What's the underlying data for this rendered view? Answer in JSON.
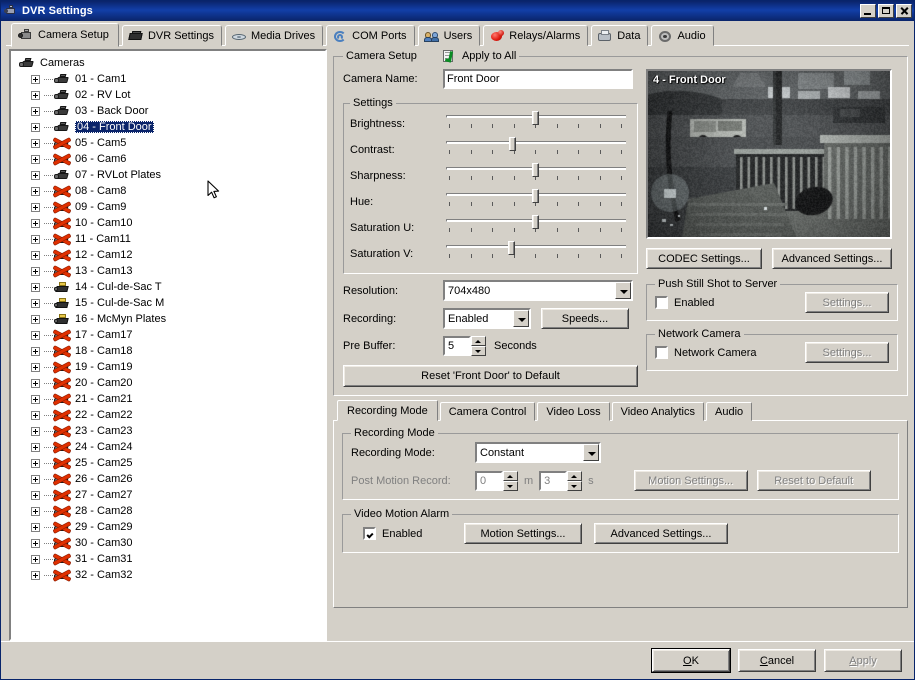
{
  "window": {
    "title": "DVR Settings",
    "icon": "camera-icon",
    "controls": {
      "minimize": "minimize-icon",
      "maximize": "maximize-icon",
      "close": "close-icon"
    }
  },
  "main_tabs": [
    {
      "label": "Camera Setup",
      "icon": "camera-icon",
      "active": true
    },
    {
      "label": "DVR Settings",
      "icon": "dvr-icon",
      "active": false
    },
    {
      "label": "Media Drives",
      "icon": "disc-icon",
      "active": false
    },
    {
      "label": "COM Ports",
      "icon": "com-port-icon",
      "active": false
    },
    {
      "label": "Users",
      "icon": "users-icon",
      "active": false
    },
    {
      "label": "Relays/Alarms",
      "icon": "relay-icon",
      "active": false
    },
    {
      "label": "Data",
      "icon": "data-icon",
      "active": false
    },
    {
      "label": "Audio",
      "icon": "audio-icon",
      "active": false
    }
  ],
  "tree": {
    "root_label": "Cameras",
    "root_icon": "camera-icon",
    "nodes": [
      {
        "label": "01 - Cam1",
        "icon": "camera-icon",
        "selected": false
      },
      {
        "label": "02 - RV Lot",
        "icon": "camera-icon",
        "selected": false
      },
      {
        "label": "03 - Back Door",
        "icon": "camera-icon",
        "selected": false
      },
      {
        "label": "04 - Front Door",
        "icon": "camera-icon",
        "selected": true
      },
      {
        "label": "05 - Cam5",
        "icon": "camera-disabled-icon",
        "selected": false
      },
      {
        "label": "06 - Cam6",
        "icon": "camera-disabled-icon",
        "selected": false
      },
      {
        "label": "07 - RVLot Plates",
        "icon": "camera-icon",
        "selected": false
      },
      {
        "label": "08 - Cam8",
        "icon": "camera-disabled-icon",
        "selected": false
      },
      {
        "label": "09 - Cam9",
        "icon": "camera-disabled-icon",
        "selected": false
      },
      {
        "label": "10 - Cam10",
        "icon": "camera-disabled-icon",
        "selected": false
      },
      {
        "label": "11 - Cam11",
        "icon": "camera-disabled-icon",
        "selected": false
      },
      {
        "label": "12 - Cam12",
        "icon": "camera-disabled-icon",
        "selected": false
      },
      {
        "label": "13 - Cam13",
        "icon": "camera-disabled-icon",
        "selected": false
      },
      {
        "label": "14 - Cul-de-Sac T",
        "icon": "camera-ptz-icon",
        "selected": false
      },
      {
        "label": "15 - Cul-de-Sac M",
        "icon": "camera-ptz-icon",
        "selected": false
      },
      {
        "label": "16 - McMyn Plates",
        "icon": "camera-ptz-icon",
        "selected": false
      },
      {
        "label": "17 - Cam17",
        "icon": "camera-disabled-icon",
        "selected": false
      },
      {
        "label": "18 - Cam18",
        "icon": "camera-disabled-icon",
        "selected": false
      },
      {
        "label": "19 - Cam19",
        "icon": "camera-disabled-icon",
        "selected": false
      },
      {
        "label": "20 - Cam20",
        "icon": "camera-disabled-icon",
        "selected": false
      },
      {
        "label": "21 - Cam21",
        "icon": "camera-disabled-icon",
        "selected": false
      },
      {
        "label": "22 - Cam22",
        "icon": "camera-disabled-icon",
        "selected": false
      },
      {
        "label": "23 - Cam23",
        "icon": "camera-disabled-icon",
        "selected": false
      },
      {
        "label": "24 - Cam24",
        "icon": "camera-disabled-icon",
        "selected": false
      },
      {
        "label": "25 - Cam25",
        "icon": "camera-disabled-icon",
        "selected": false
      },
      {
        "label": "26 - Cam26",
        "icon": "camera-disabled-icon",
        "selected": false
      },
      {
        "label": "27 - Cam27",
        "icon": "camera-disabled-icon",
        "selected": false
      },
      {
        "label": "28 - Cam28",
        "icon": "camera-disabled-icon",
        "selected": false
      },
      {
        "label": "29 - Cam29",
        "icon": "camera-disabled-icon",
        "selected": false
      },
      {
        "label": "30 - Cam30",
        "icon": "camera-disabled-icon",
        "selected": false
      },
      {
        "label": "31 - Cam31",
        "icon": "camera-disabled-icon",
        "selected": false
      },
      {
        "label": "32 - Cam32",
        "icon": "camera-disabled-icon",
        "selected": false
      }
    ]
  },
  "camera_setup": {
    "group_title": "Camera Setup",
    "apply_to_all_label": "Apply to All",
    "camera_name_label": "Camera Name:",
    "camera_name_value": "Front Door",
    "settings_group_title": "Settings",
    "sliders": [
      {
        "label": "Brightness:",
        "value": 50
      },
      {
        "label": "Contrast:",
        "value": 37
      },
      {
        "label": "Sharpness:",
        "value": 50
      },
      {
        "label": "Hue:",
        "value": 50
      },
      {
        "label": "Saturation U:",
        "value": 50
      },
      {
        "label": "Saturation V:",
        "value": 36
      }
    ],
    "slider_tick_count": 9,
    "resolution_label": "Resolution:",
    "resolution_value": "704x480",
    "recording_label": "Recording:",
    "recording_value": "Enabled",
    "speeds_button": "Speeds...",
    "pre_buffer_label": "Pre Buffer:",
    "pre_buffer_value": "5",
    "pre_buffer_units": "Seconds",
    "reset_button": "Reset 'Front Door' to Default"
  },
  "preview": {
    "overlay_label": "4 - Front Door"
  },
  "right_column": {
    "codec_button": "CODEC Settings...",
    "advanced_button": "Advanced Settings...",
    "push_still": {
      "group_title": "Push Still Shot to Server",
      "enabled_label": "Enabled",
      "enabled_checked": false,
      "settings_button": "Settings...",
      "settings_disabled": true
    },
    "network_camera": {
      "group_title": "Network Camera",
      "enabled_label": "Network Camera",
      "enabled_checked": false,
      "settings_button": "Settings...",
      "settings_disabled": true
    }
  },
  "bottom_tabs": [
    {
      "label": "Recording Mode",
      "active": true
    },
    {
      "label": "Camera Control",
      "active": false
    },
    {
      "label": "Video Loss",
      "active": false
    },
    {
      "label": "Video Analytics",
      "active": false
    },
    {
      "label": "Audio",
      "active": false
    }
  ],
  "recording_mode_panel": {
    "group_title": "Recording Mode",
    "mode_label": "Recording Mode:",
    "mode_value": "Constant",
    "post_motion_label": "Post Motion Record:",
    "post_motion_minutes": "0",
    "post_motion_minutes_unit": "m",
    "post_motion_seconds": "3",
    "post_motion_seconds_unit": "s",
    "post_motion_disabled": true,
    "motion_settings_button": "Motion Settings...",
    "motion_settings_disabled": true,
    "reset_to_default_button": "Reset to Default",
    "reset_to_default_disabled": true
  },
  "video_motion_alarm": {
    "group_title": "Video Motion Alarm",
    "enabled_label": "Enabled",
    "enabled_checked": true,
    "motion_settings_button": "Motion Settings...",
    "advanced_settings_button": "Advanced Settings..."
  },
  "footer": {
    "ok": "OK",
    "ok_accel": "O",
    "cancel": "Cancel",
    "cancel_accel": "C",
    "apply": "Apply",
    "apply_accel": "A",
    "apply_disabled": true
  },
  "colors": {
    "face": "#d4d0c8",
    "title_bar": "#0a246a",
    "selection": "#0a246a",
    "window": "#ffffff",
    "disabled_text": "#808080",
    "alarm_red": "#e01b10",
    "check_green": "#0a8c24"
  }
}
